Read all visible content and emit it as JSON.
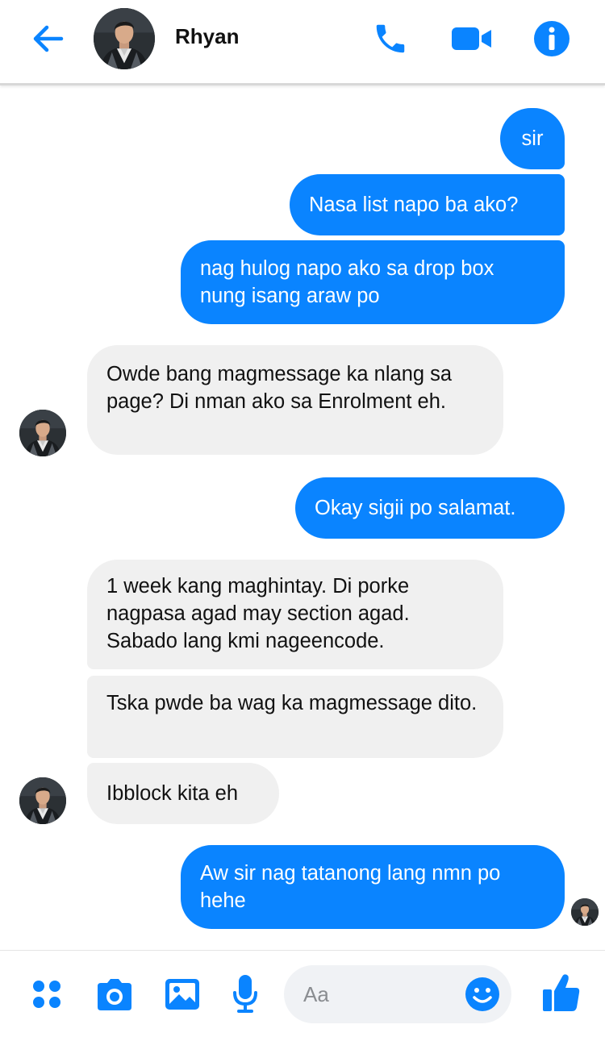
{
  "header": {
    "contact_name": "Rhyan",
    "icons": {
      "back": "arrow-left-icon",
      "call": "phone-icon",
      "video": "video-camera-icon",
      "info": "info-icon"
    }
  },
  "messages": [
    {
      "from": "me",
      "text": "sir"
    },
    {
      "from": "me",
      "text": "Nasa list napo ba ako?"
    },
    {
      "from": "me",
      "text": "nag hulog napo ako sa drop box nung isang araw po"
    },
    {
      "from": "them",
      "text": "Owde bang magmessage ka nlang sa page? Di nman ako sa Enrolment eh."
    },
    {
      "from": "me",
      "text": "Okay sigii po salamat."
    },
    {
      "from": "them",
      "text": "1 week kang maghintay. Di porke nagpasa agad may section agad. Sabado lang kmi nageencode."
    },
    {
      "from": "them",
      "text": "Tska pwde ba wag ka magmessage dito."
    },
    {
      "from": "them",
      "text": "Ibblock kita eh"
    },
    {
      "from": "me",
      "text": "Aw sir nag tatanong lang nmn po hehe"
    }
  ],
  "composer": {
    "placeholder": "Aa",
    "icons": [
      "more-apps-icon",
      "camera-icon",
      "gallery-icon",
      "microphone-icon",
      "emoji-icon",
      "thumbs-up-icon"
    ]
  },
  "colors": {
    "accent": "#0a84ff",
    "incoming_bubble": "#f0f0f0",
    "outgoing_text": "#ffffff"
  }
}
